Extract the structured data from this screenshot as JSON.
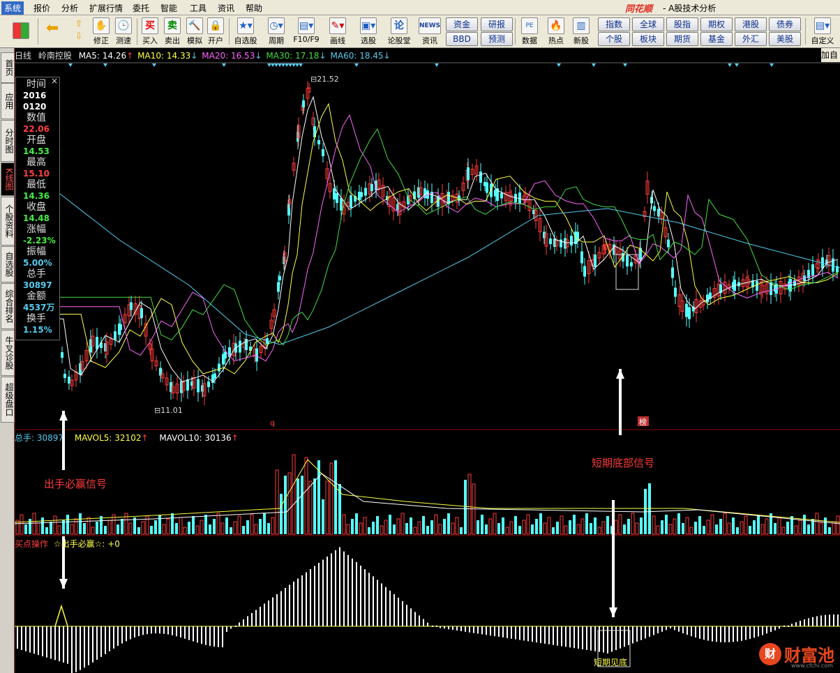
{
  "menu": {
    "items": [
      "系统",
      "报价",
      "分析",
      "扩展行情",
      "委托",
      "智能",
      "工具",
      "资讯",
      "帮助"
    ],
    "active": "系统"
  },
  "window": {
    "brand": "同花顺",
    "subtitle": "- A股技术分析",
    "ad_panel_label": "加自"
  },
  "toolbar": {
    "buttons": [
      "修正",
      "测速",
      "买入",
      "卖出",
      "模拟",
      "开户",
      "自选股",
      "周期",
      "F10/F9",
      "画线",
      "选股",
      "论股堂",
      "资讯",
      "数据",
      "热点",
      "新股"
    ],
    "news_label": "NEWS",
    "quick_row1": [
      "资金",
      "研报",
      "指数",
      "全球",
      "股指",
      "期权",
      "港股",
      "债券"
    ],
    "quick_row2": [
      "BBD",
      "预测",
      "个股",
      "板块",
      "期货",
      "基金",
      "外汇",
      "美股"
    ],
    "customize": "自定义",
    "buy_glyph": "买",
    "sell_glyph": "卖"
  },
  "left_nav": [
    "首页",
    "应用",
    "分时图",
    "K线图",
    "个股资料",
    "自选股",
    "综合排名",
    "牛叉诊股",
    "超级盘口"
  ],
  "left_nav_active": "K线图",
  "chart": {
    "period": "日线",
    "stock_name": "岭南控股",
    "ma": [
      {
        "label": "MA5: 14.26",
        "dir": "↑",
        "color": "#ffffff"
      },
      {
        "label": "MA10: 14.33",
        "dir": "↓",
        "color": "#ffff44"
      },
      {
        "label": "MA20: 16.53",
        "dir": "↓",
        "color": "#ff66ff"
      },
      {
        "label": "MA30: 17.18",
        "dir": "↓",
        "color": "#44dd44"
      },
      {
        "label": "MA60: 18.45",
        "dir": "↓",
        "color": "#55ccee"
      }
    ],
    "high_marker": "21.52",
    "low_marker": "11.01",
    "q_marker": "q",
    "bang_marker": "榜"
  },
  "info_box": {
    "close_glyph": "×",
    "rows": [
      {
        "label": "时间",
        "value": "2016",
        "color": "#ffffff"
      },
      {
        "label": "",
        "value": "0120",
        "color": "#ffffff"
      },
      {
        "label": "数值",
        "value": "22.06",
        "color": "#ff4040"
      },
      {
        "label": "开盘",
        "value": "14.53",
        "color": "#44ee44"
      },
      {
        "label": "最高",
        "value": "15.10",
        "color": "#ff4040"
      },
      {
        "label": "最低",
        "value": "14.36",
        "color": "#44ee44"
      },
      {
        "label": "收盘",
        "value": "14.48",
        "color": "#44ee44"
      },
      {
        "label": "涨幅",
        "value": "-2.23%",
        "color": "#44ee44"
      },
      {
        "label": "振幅",
        "value": "5.00%",
        "color": "#55ccee"
      },
      {
        "label": "总手",
        "value": "30897",
        "color": "#55ccee"
      },
      {
        "label": "金额",
        "value": "4537万",
        "color": "#55ccee"
      },
      {
        "label": "换手",
        "value": "1.15%",
        "color": "#55ccee"
      }
    ]
  },
  "volume": {
    "total_label": "总手: 30897",
    "mavol5": "MAVOL5: 32102",
    "mavol10": "MAVOL10: 30136",
    "up_arrow": "↑"
  },
  "indicator": {
    "title": "买点操作",
    "formula": "☆出手必赢☆: +0",
    "box_label": "短期见底"
  },
  "annotations": {
    "buy_signal": "出手必赢信号",
    "bottom_signal": "短期底部信号"
  },
  "watermark": {
    "text": "财富池",
    "url": "www.cfchi.com",
    "badge": "财"
  },
  "colors": {
    "up": "#ff3b3b",
    "down": "#54ffff",
    "ma5": "#ffffff",
    "ma10": "#ffff44",
    "ma20": "#ff66ff",
    "ma30": "#44dd44",
    "ma60": "#55ccee",
    "annotation": "#ff3b3b",
    "grid": "#8b0000"
  }
}
